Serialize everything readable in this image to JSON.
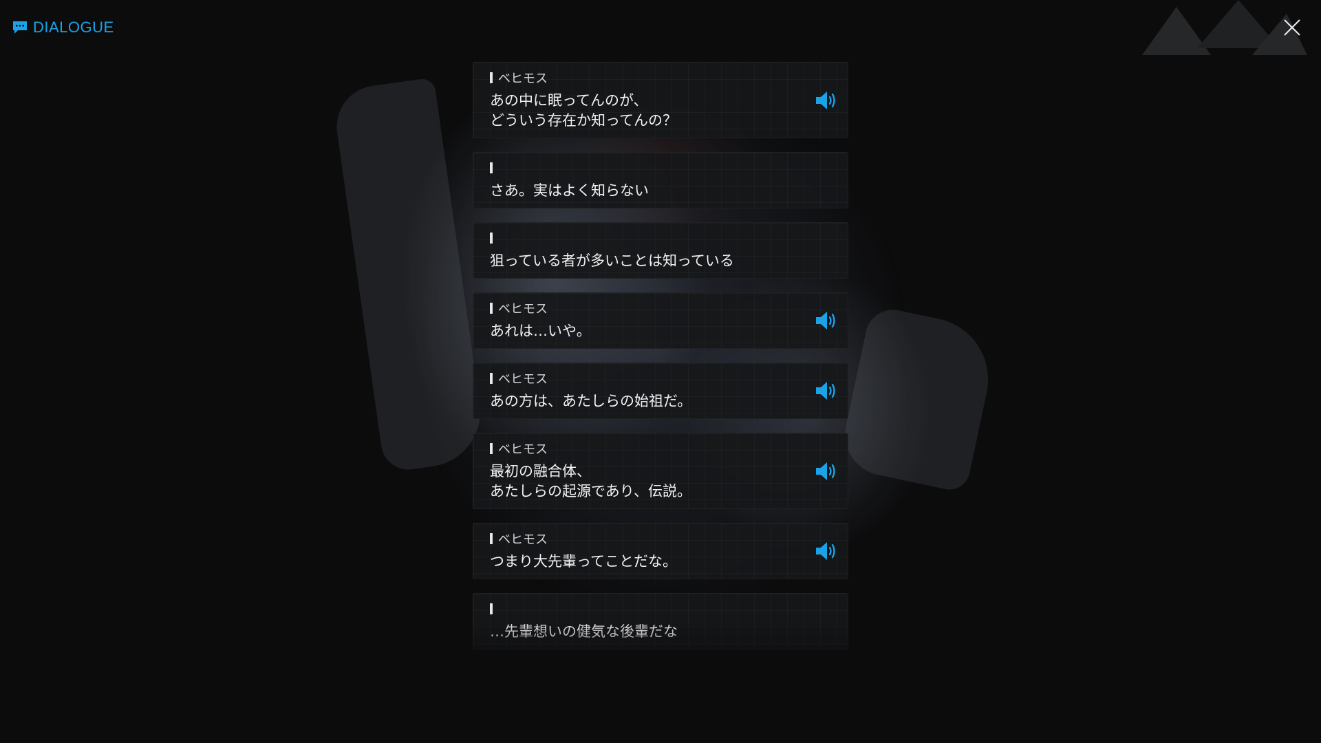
{
  "header": {
    "title": "DIALOGUE"
  },
  "colors": {
    "accent": "#1aa3e8",
    "background": "#0c0c0d",
    "entry_bg": "#161719",
    "text": "#f2f2f2"
  },
  "icons": {
    "title_icon": "chat-bubble-icon",
    "close_icon": "close-icon",
    "voice_icon": "speaker-volume-icon"
  },
  "entries": [
    {
      "speaker": "ベヒモス",
      "text": "あの中に眠ってんのが、\nどういう存在か知ってんの？",
      "has_voice": true
    },
    {
      "speaker": "",
      "text": "さあ。実はよく知らない",
      "has_voice": false
    },
    {
      "speaker": "",
      "text": "狙っている者が多いことは知っている",
      "has_voice": false
    },
    {
      "speaker": "ベヒモス",
      "text": "あれは…いや。",
      "has_voice": true
    },
    {
      "speaker": "ベヒモス",
      "text": "あの方は、あたしらの始祖だ。",
      "has_voice": true
    },
    {
      "speaker": "ベヒモス",
      "text": "最初の融合体、\nあたしらの起源であり、伝説。",
      "has_voice": true
    },
    {
      "speaker": "ベヒモス",
      "text": "つまり大先輩ってことだな。",
      "has_voice": true
    },
    {
      "speaker": "",
      "text": "…先輩想いの健気な後輩だな",
      "has_voice": false
    }
  ]
}
